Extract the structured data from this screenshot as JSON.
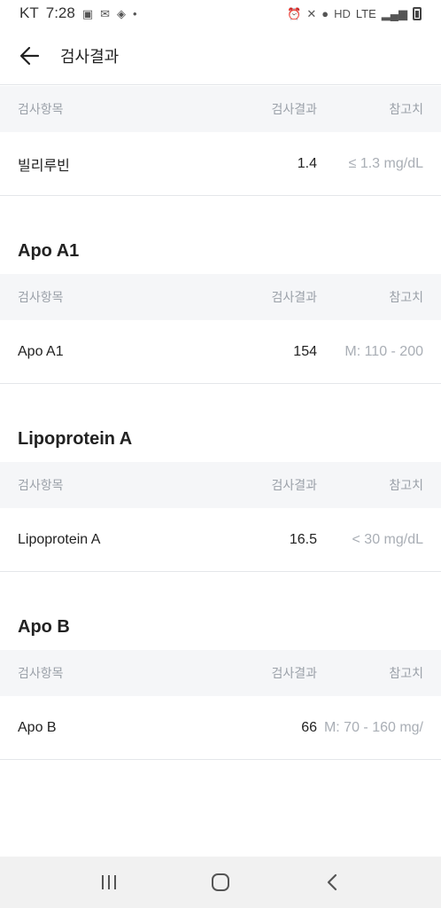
{
  "status_bar": {
    "carrier": "KT",
    "time": "7:28",
    "network": "LTE"
  },
  "header": {
    "title": "검사결과"
  },
  "table_headers": {
    "item": "검사항목",
    "result": "검사결과",
    "reference": "참고치"
  },
  "sections": [
    {
      "title": "",
      "rows": [
        {
          "item": "빌리루빈",
          "result": "1.4",
          "reference": "≤ 1.3 mg/dL"
        }
      ]
    },
    {
      "title": "Apo A1",
      "rows": [
        {
          "item": "Apo A1",
          "result": "154",
          "reference": "M: 110 - 200"
        }
      ]
    },
    {
      "title": "Lipoprotein A",
      "rows": [
        {
          "item": "Lipoprotein A",
          "result": "16.5",
          "reference": "< 30 mg/dL"
        }
      ]
    },
    {
      "title": "Apo B",
      "rows": [
        {
          "item": "Apo B",
          "result": "66",
          "reference": "M: 70 - 160 mg/"
        }
      ]
    }
  ],
  "icons": {
    "back": "arrow-left-icon",
    "nav_recent": "recent-apps-icon",
    "nav_home": "home-icon",
    "nav_back": "chevron-left-icon"
  }
}
